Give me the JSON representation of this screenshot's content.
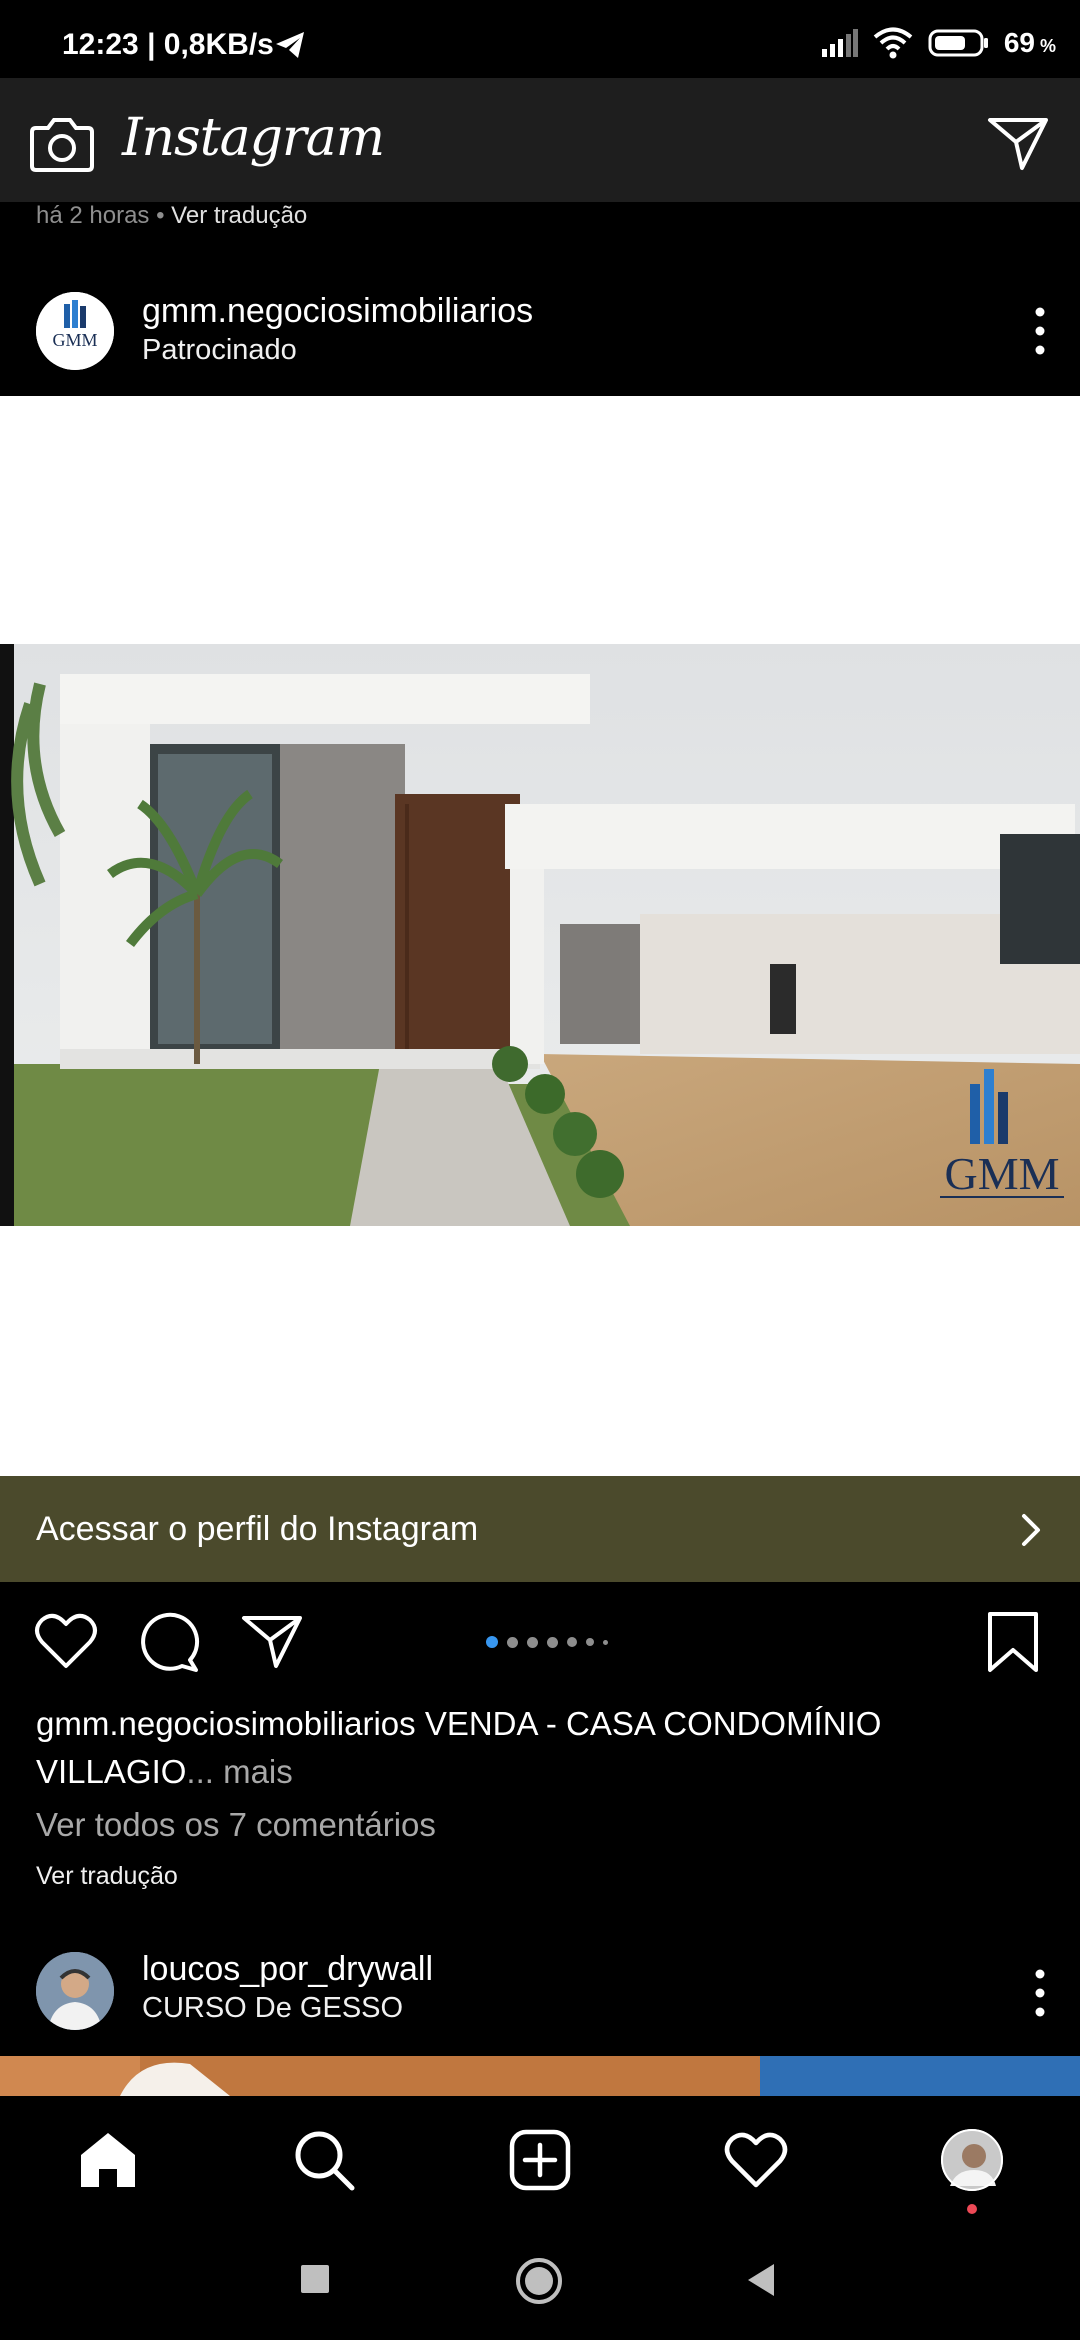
{
  "status_bar": {
    "time": "12:23 | 0,8KB/s",
    "battery": "69"
  },
  "header": {
    "logo": "Instagram"
  },
  "previous_post": {
    "time_ago": "há 2 horas",
    "separator": " • ",
    "translate": "Ver tradução"
  },
  "post": {
    "username": "gmm.negociosimobiliarios",
    "subtitle": "Patrocinado",
    "image_watermark": "GMM",
    "cta_label": "Acessar o perfil do Instagram",
    "carousel": {
      "count": 7,
      "active": 1
    },
    "caption_user": "gmm.negociosimobiliarios",
    "caption_text": " VENDA - CASA CONDOMÍNIO VILLAGIO",
    "caption_more": "... mais",
    "view_comments": "Ver todos os 7 comentários",
    "see_translation": "Ver tradução"
  },
  "next_post": {
    "username": "loucos_por_drywall",
    "subtitle": "CURSO De GESSO"
  },
  "colors": {
    "cta_bg": "#4b4a2c",
    "header_bg": "#1e1e1e",
    "active_dot": "#3897f0",
    "notification_dot": "#ed4956"
  }
}
